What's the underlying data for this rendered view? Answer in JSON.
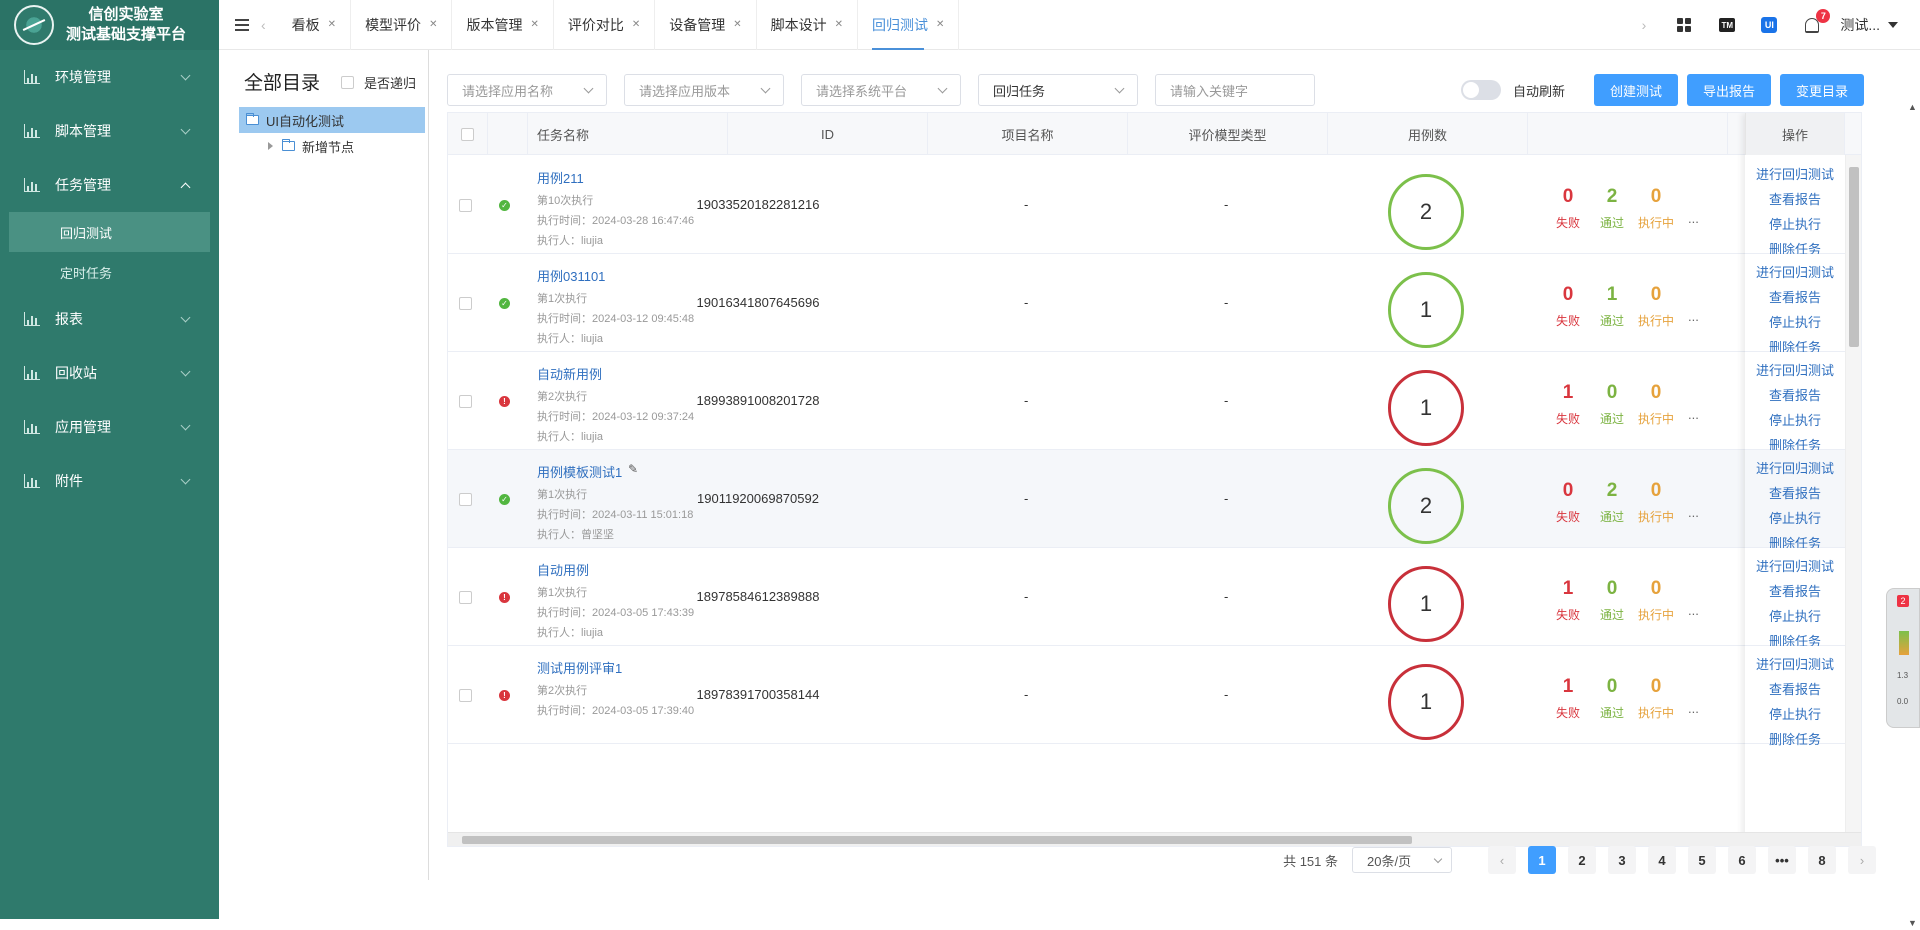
{
  "brand": {
    "line1": "信创实验室",
    "line2": "测试基础支撑平台"
  },
  "sidebar": {
    "items": [
      {
        "label": "环境管理",
        "expanded": false
      },
      {
        "label": "脚本管理",
        "expanded": false
      },
      {
        "label": "任务管理",
        "expanded": true,
        "children": [
          {
            "label": "回归测试",
            "active": true
          },
          {
            "label": "定时任务",
            "active": false
          }
        ]
      },
      {
        "label": "报表",
        "expanded": false
      },
      {
        "label": "回收站",
        "expanded": false
      },
      {
        "label": "应用管理",
        "expanded": false
      },
      {
        "label": "附件",
        "expanded": false
      }
    ]
  },
  "tabs": [
    {
      "label": "看板"
    },
    {
      "label": "模型评价"
    },
    {
      "label": "版本管理"
    },
    {
      "label": "评价对比"
    },
    {
      "label": "设备管理"
    },
    {
      "label": "脚本设计"
    },
    {
      "label": "回归测试",
      "active": true
    }
  ],
  "topright": {
    "tm": "TM",
    "ui": "UI",
    "notifications": "7",
    "user": "测试..."
  },
  "tree": {
    "title": "全部目录",
    "recursive_label": "是否递归",
    "root": "UI自动化测试",
    "child": "新增节点"
  },
  "filters": {
    "app_name": "请选择应用名称",
    "app_version": "请选择应用版本",
    "platform": "请选择系统平台",
    "task_type": "回归任务",
    "keyword": "请输入关键字"
  },
  "actions": {
    "auto_refresh": "自动刷新",
    "create": "创建测试",
    "export": "导出报告",
    "change_dir": "变更目录"
  },
  "table": {
    "headers": {
      "name": "任务名称",
      "id": "ID",
      "project": "项目名称",
      "model": "评价模型类型",
      "cases": "用例数",
      "ops": "操作"
    },
    "stat_labels": {
      "fail": "失败",
      "pass": "通过",
      "running": "执行中"
    },
    "op_labels": [
      "进行回归测试",
      "查看报告",
      "停止执行",
      "删除任务"
    ],
    "more": "...",
    "rows": [
      {
        "name": "用例211",
        "runs": "第10次执行",
        "time": "执行时间：2024-03-28 16:47:46",
        "executor": "执行人：liujia",
        "id": "19033520182281216",
        "project": "-",
        "model": "-",
        "cases": "2",
        "fail": "0",
        "pass": "2",
        "running": "0",
        "status": "ok"
      },
      {
        "name": "用例031101",
        "runs": "第1次执行",
        "time": "执行时间：2024-03-12 09:45:48",
        "executor": "执行人：liujia",
        "id": "19016341807645696",
        "project": "-",
        "model": "-",
        "cases": "1",
        "fail": "0",
        "pass": "1",
        "running": "0",
        "status": "ok"
      },
      {
        "name": "自动新用例",
        "runs": "第2次执行",
        "time": "执行时间：2024-03-12 09:37:24",
        "executor": "执行人：liujia",
        "id": "18993891008201728",
        "project": "-",
        "model": "-",
        "cases": "1",
        "fail": "1",
        "pass": "0",
        "running": "0",
        "status": "err"
      },
      {
        "name": "用例模板测试1",
        "runs": "第1次执行",
        "time": "执行时间：2024-03-11 15:01:18",
        "executor": "执行人：曾坚坚",
        "id": "19011920069870592",
        "project": "-",
        "model": "-",
        "cases": "2",
        "fail": "0",
        "pass": "2",
        "running": "0",
        "status": "ok"
      },
      {
        "name": "自动用例",
        "runs": "第1次执行",
        "time": "执行时间：2024-03-05 17:43:39",
        "executor": "执行人：liujia",
        "id": "18978584612389888",
        "project": "-",
        "model": "-",
        "cases": "1",
        "fail": "1",
        "pass": "0",
        "running": "0",
        "status": "err"
      },
      {
        "name": "测试用例评审1",
        "runs": "第2次执行",
        "time": "执行时间：2024-03-05 17:39:40",
        "executor": "",
        "id": "18978391700358144",
        "project": "-",
        "model": "-",
        "cases": "1",
        "fail": "1",
        "pass": "0",
        "running": "0",
        "status": "err"
      }
    ]
  },
  "pagination": {
    "total": "共 151 条",
    "page_size": "20条/页",
    "pages": [
      "1",
      "2",
      "3",
      "4",
      "5",
      "6",
      "•••",
      "8"
    ],
    "current": "1"
  },
  "widget": {
    "badge": "2",
    "up": "1.3",
    "down": "0.0"
  }
}
